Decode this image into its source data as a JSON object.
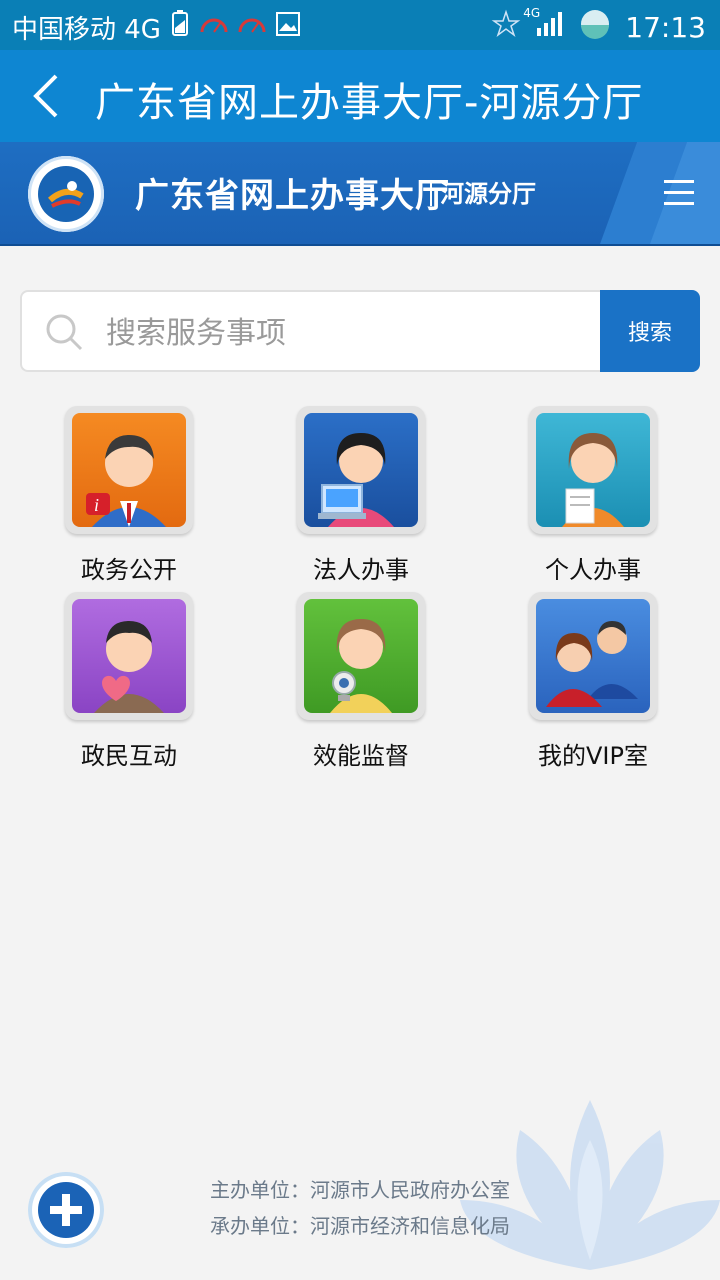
{
  "status_bar": {
    "carrier": "中国移动 4G",
    "network": "4G",
    "time": "17:13"
  },
  "app_bar": {
    "title": "广东省网上办事大厅-河源分厅"
  },
  "banner": {
    "main_title": "广东省网上办事大厅",
    "sub_title": "河源分厅"
  },
  "search": {
    "placeholder": "搜索服务事项",
    "button_label": "搜索"
  },
  "grid": {
    "items": [
      {
        "label": "政务公开",
        "icon": "male-officer-info-icon",
        "color": "#f07c1a"
      },
      {
        "label": "法人办事",
        "icon": "female-computer-icon",
        "color": "#1f62b8"
      },
      {
        "label": "个人办事",
        "icon": "female-document-icon",
        "color": "#27a7c8"
      },
      {
        "label": "政民互动",
        "icon": "male-heart-icon",
        "color": "#9b57d0"
      },
      {
        "label": "效能监督",
        "icon": "female-camera-icon",
        "color": "#5aaf35"
      },
      {
        "label": "我的VIP室",
        "icon": "vip-couple-icon",
        "color": "#3b7ed5"
      }
    ]
  },
  "footer": {
    "host": "主办单位：河源市人民政府办公室",
    "organizer": "承办单位：河源市经济和信息化局"
  }
}
